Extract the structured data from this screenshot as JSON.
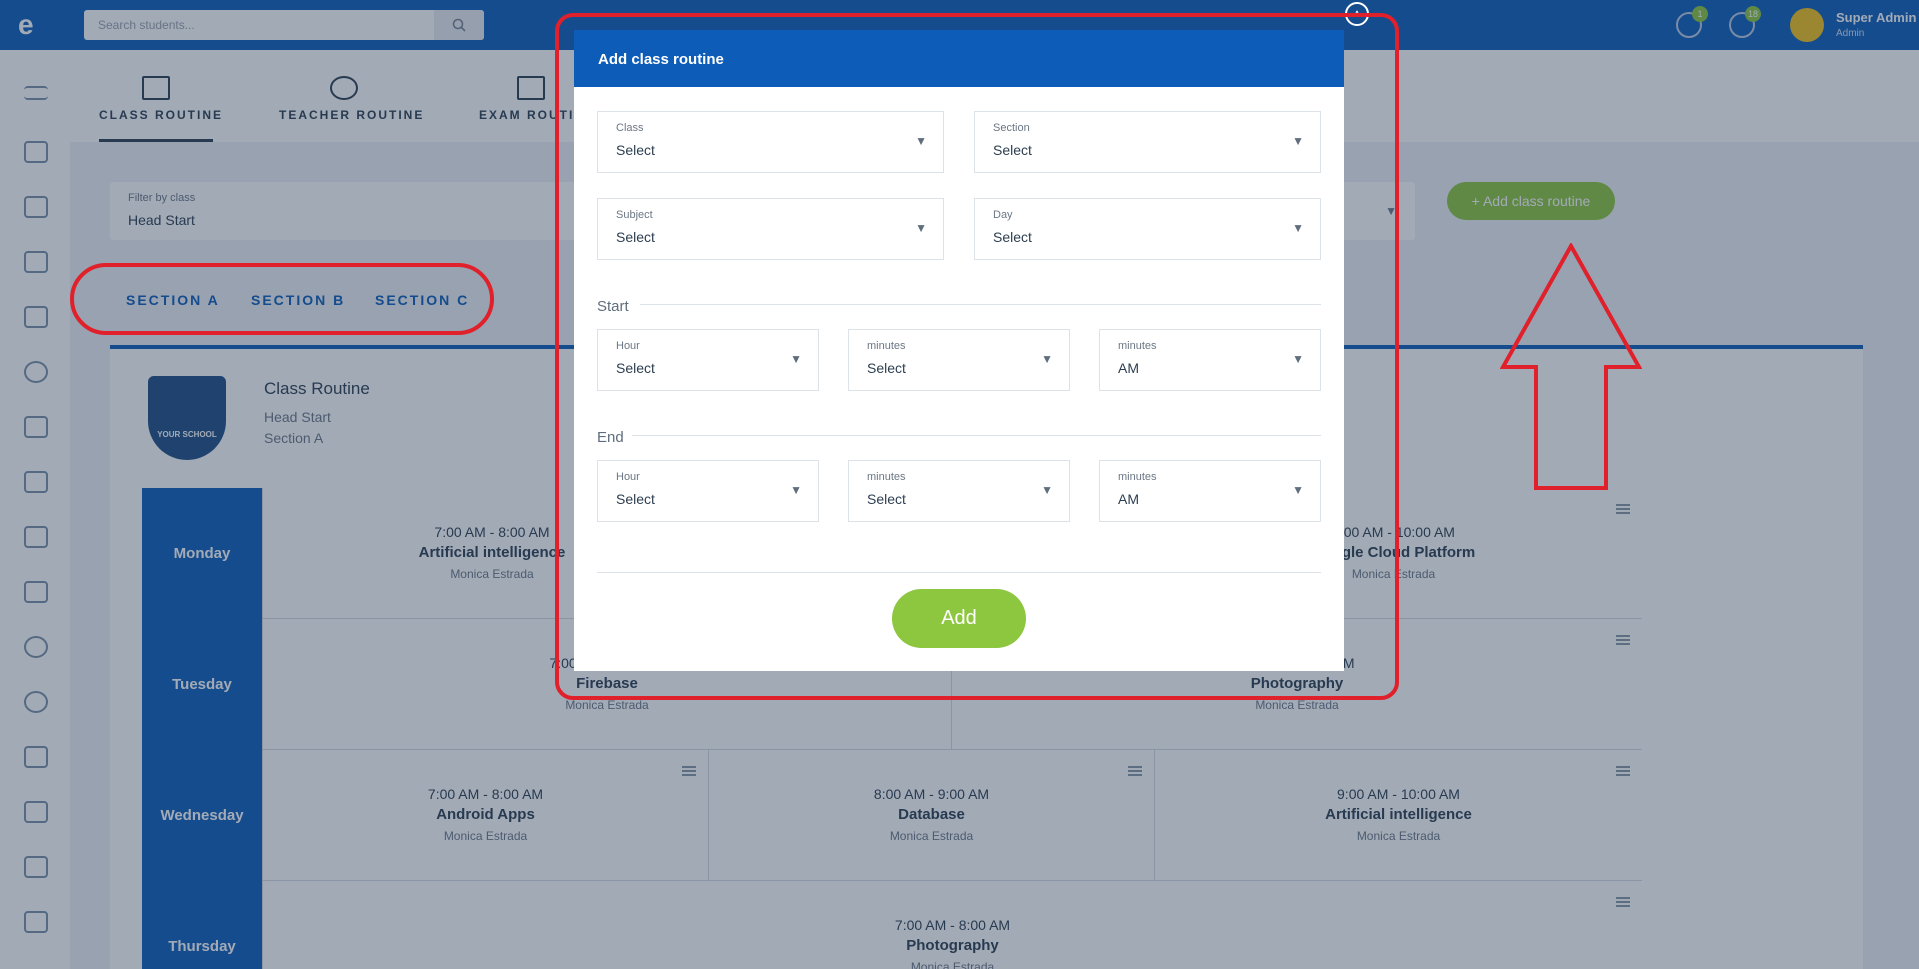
{
  "topbar": {
    "search_placeholder": "Search students...",
    "notifications": [
      {
        "icon": "chat-icon",
        "count": "1"
      },
      {
        "icon": "globe-icon",
        "count": "18"
      }
    ],
    "user": {
      "name": "Super Admin",
      "role": "Admin"
    }
  },
  "tabs": [
    {
      "label": "CLASS ROUTINE",
      "icon": "calendar-icon"
    },
    {
      "label": "TEACHER ROUTINE",
      "icon": "glasses-icon"
    },
    {
      "label": "EXAM ROUTINE",
      "icon": "book-icon"
    }
  ],
  "filter": {
    "label": "Filter by class",
    "value": "Head Start"
  },
  "add_routine_label": "+ Add class routine",
  "sections": [
    "SECTION A",
    "SECTION B",
    "SECTION C"
  ],
  "routine": {
    "crest_text": "YOUR SCHOOL",
    "title": "Class Routine",
    "class_name": "Head Start",
    "section_name": "Section A",
    "days": [
      {
        "day": "Monday",
        "slots": [
          {
            "time": "7:00 AM - 8:00 AM",
            "subject": "Artificial intelligence",
            "teacher": "Monica Estrada"
          },
          {
            "time": "9:00 AM - 10:00 AM",
            "subject": "Google Cloud Platform",
            "teacher": "Monica Estrada"
          }
        ]
      },
      {
        "day": "Tuesday",
        "slots": [
          {
            "time": "7:00 AM - 8:00 AM",
            "subject": "Firebase",
            "teacher": "Monica Estrada"
          },
          {
            "time": "8:00 AM - 9:00 AM",
            "subject": "Photography",
            "teacher": "Monica Estrada"
          }
        ]
      },
      {
        "day": "Wednesday",
        "slots": [
          {
            "time": "7:00 AM - 8:00 AM",
            "subject": "Android Apps",
            "teacher": "Monica Estrada"
          },
          {
            "time": "8:00 AM - 9:00 AM",
            "subject": "Database",
            "teacher": "Monica Estrada"
          },
          {
            "time": "9:00 AM - 10:00 AM",
            "subject": "Artificial intelligence",
            "teacher": "Monica Estrada"
          }
        ]
      },
      {
        "day": "Thursday",
        "slots": [
          {
            "time": "7:00 AM - 8:00 AM",
            "subject": "Photography",
            "teacher": "Monica Estrada"
          }
        ]
      }
    ]
  },
  "modal": {
    "title": "Add class routine",
    "class_field": {
      "label": "Class",
      "value": "Select"
    },
    "section_field": {
      "label": "Section",
      "value": "Select"
    },
    "subject_field": {
      "label": "Subject",
      "value": "Select"
    },
    "day_field": {
      "label": "Day",
      "value": "Select"
    },
    "start_label": "Start",
    "start_hour": {
      "label": "Hour",
      "value": "Select"
    },
    "start_minutes": {
      "label": "minutes",
      "value": "Select"
    },
    "start_ampm": {
      "label": "minutes",
      "value": "AM"
    },
    "end_label": "End",
    "end_hour": {
      "label": "Hour",
      "value": "Select"
    },
    "end_minutes": {
      "label": "minutes",
      "value": "Select"
    },
    "end_ampm": {
      "label": "minutes",
      "value": "AM"
    },
    "add_label": "Add"
  },
  "colors": {
    "primary": "#0d5db8",
    "accent": "#8dc63f",
    "annotation": "#e0202a"
  }
}
